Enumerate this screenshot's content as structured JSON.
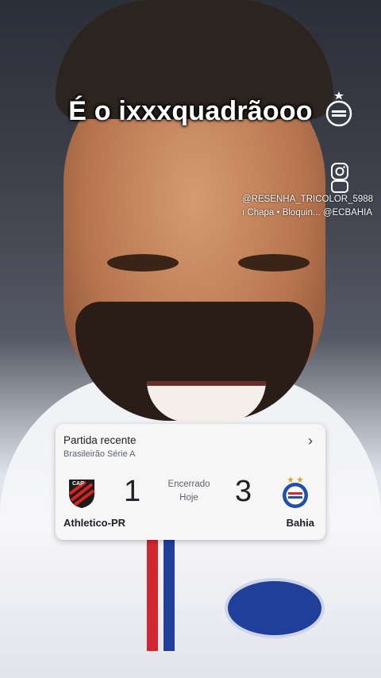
{
  "overlay": {
    "caption": "É o ixxxquadrãooo",
    "handle": "@RESENHA_TRICOLOR_5988",
    "subhandle": "ı Chapa • Bloquin... @ECBAHIA"
  },
  "match_card": {
    "title": "Partida recente",
    "competition": "Brasileirão Série A",
    "status": "Encerrado",
    "when": "Hoje",
    "home": {
      "name": "Athletico-PR",
      "score": "1",
      "logo_icon": "athletico-pr-crest-icon"
    },
    "away": {
      "name": "Bahia",
      "score": "3",
      "logo_icon": "bahia-crest-icon"
    },
    "colors": {
      "card_bg": "#f6f6f7",
      "text": "#202124",
      "muted": "#5f6368"
    }
  }
}
